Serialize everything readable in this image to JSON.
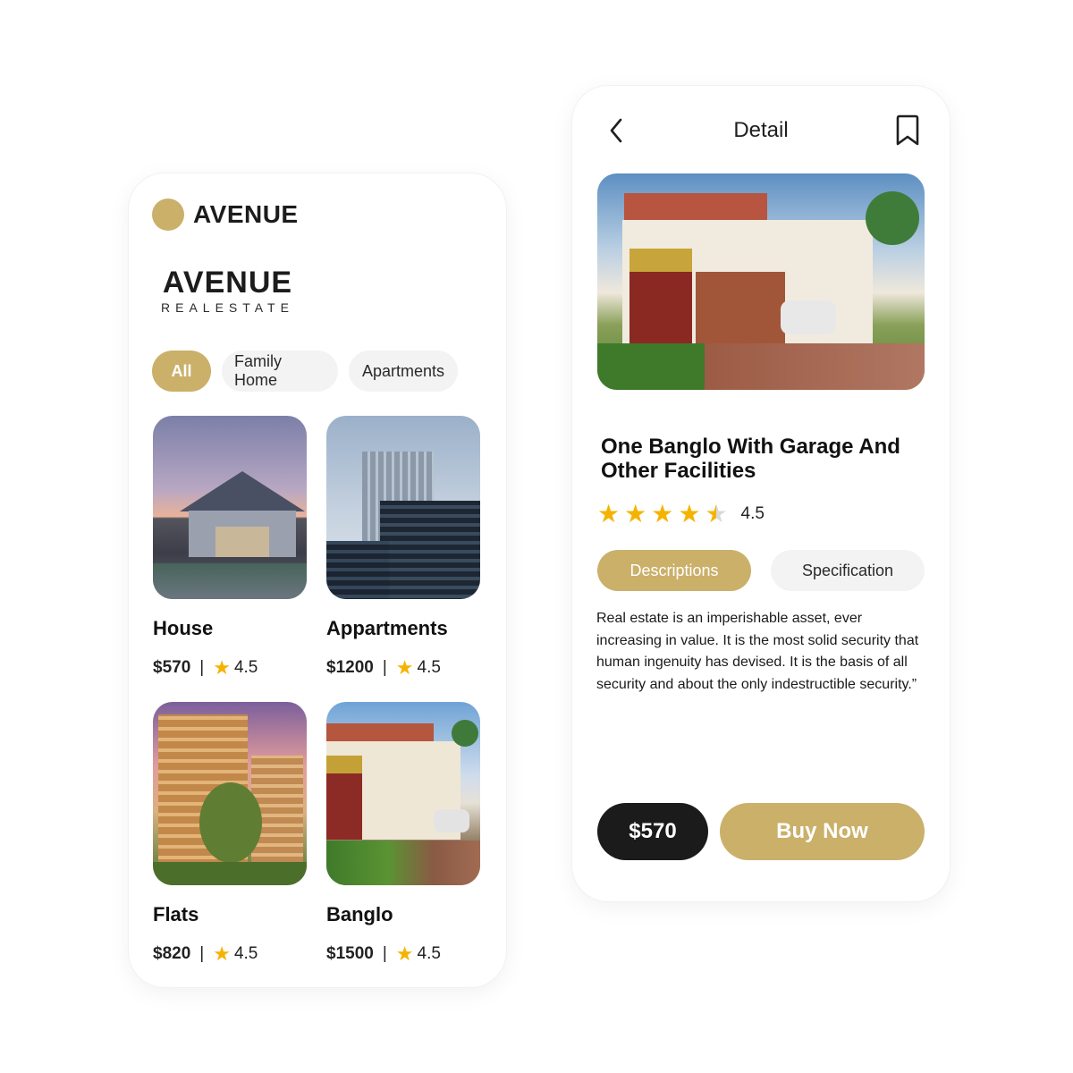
{
  "left_screen": {
    "logo_text": "AVENUE",
    "brand": {
      "title": "AVENUE",
      "subtitle": "REALESTATE"
    },
    "filters": [
      {
        "label": "All",
        "active": true
      },
      {
        "label": "Family Home",
        "active": false
      },
      {
        "label": "Apartments",
        "active": false
      }
    ],
    "listings": [
      {
        "title": "House",
        "price": "$570",
        "separator": "|",
        "rating": "4.5"
      },
      {
        "title": "Appartments",
        "price": "$1200",
        "separator": "|",
        "rating": "4.5"
      },
      {
        "title": "Flats",
        "price": "$820",
        "separator": "|",
        "rating": "4.5"
      },
      {
        "title": "Banglo",
        "price": "$1500",
        "separator": "|",
        "rating": "4.5"
      }
    ]
  },
  "right_screen": {
    "header": {
      "title": "Detail",
      "back_icon": "chevron-left-icon",
      "bookmark_icon": "bookmark-icon"
    },
    "property_name": "One Banglo With Garage And Other Facilities",
    "rating": {
      "stars": 4.5,
      "label": "4.5"
    },
    "tabs": [
      {
        "label": "Descriptions",
        "active": true
      },
      {
        "label": "Specification",
        "active": false
      }
    ],
    "description": "Real estate is an imperishable asset, ever increasing in value. It is the most solid security that human ingenuity has devised. It is the basis of all security and about the only indestructible security.”",
    "price": "$570",
    "buy_label": "Buy Now"
  },
  "colors": {
    "accent": "#cbb06a",
    "dark": "#1b1b1b",
    "star": "#f5b301"
  }
}
